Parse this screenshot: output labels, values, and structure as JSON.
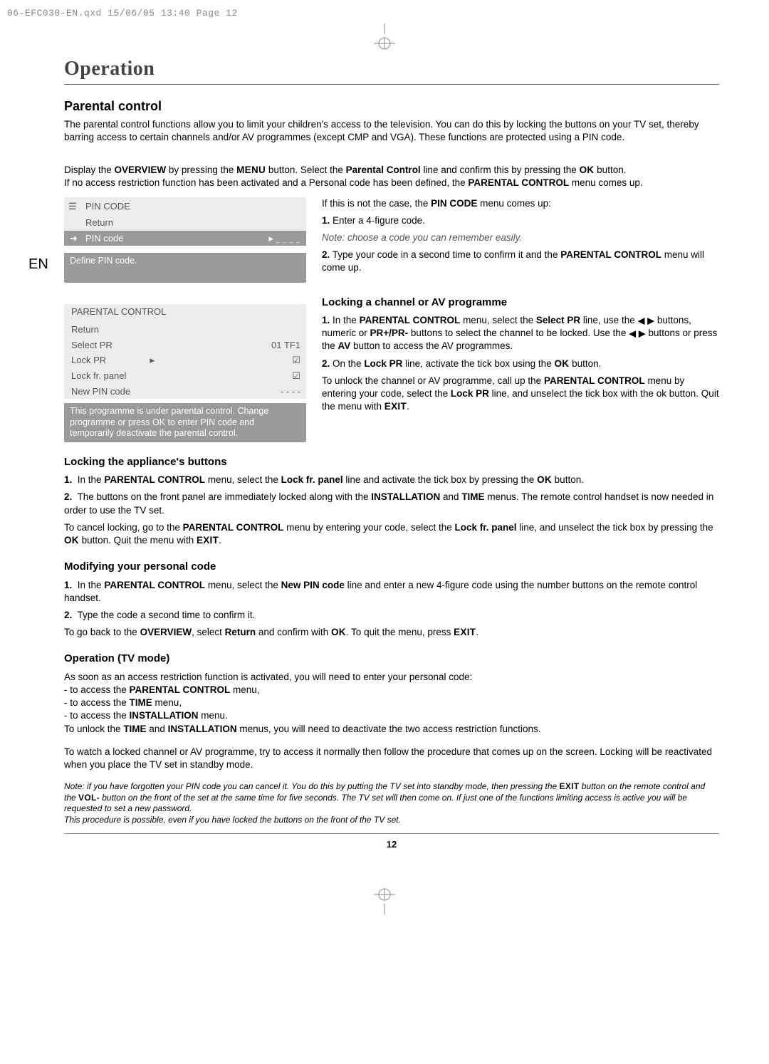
{
  "prepress": "06-EFC030-EN.qxd  15/06/05  13:40  Page 12",
  "side_tab": "EN",
  "chapter": "Operation",
  "section_title": "Parental control",
  "intro": "The parental control functions allow you to limit your children's access to the television. You can do this by locking the buttons on your TV set, thereby barring access to certain channels and/or AV programmes (except CMP and VGA). These functions are protected using a PIN code.",
  "overview_prefix": "Display the ",
  "overview_b1": "OVERVIEW",
  "overview_mid1": " by pressing the ",
  "overview_sc1": "MENU",
  "overview_mid2": " button. Select the ",
  "overview_b2": "Parental Control",
  "overview_mid3": " line and confirm this by pressing the ",
  "overview_sc2": "OK",
  "overview_end": " button.",
  "noaccess_pre": "If no access restriction function has been activated and a Personal code has been defined, the ",
  "noaccess_b": "PARENTAL CONTROL",
  "noaccess_end": " menu comes up.",
  "pin_menu": {
    "title": "PIN CODE",
    "r1": "Return",
    "r2": "PIN code",
    "info": "Define PIN code."
  },
  "pin_text": {
    "line1_pre": "If this is not the case, the ",
    "line1_b": "PIN CODE",
    "line1_end": " menu comes up:",
    "step1": "Enter a 4-figure code.",
    "note": "Note: choose a code you can remember easily.",
    "step2_pre": "Type your code in a second time to confirm it and the ",
    "step2_b": "PARENTAL CONTROL",
    "step2_end": " menu will come up."
  },
  "lock_channel": {
    "heading": "Locking a channel or AV programme",
    "s1_pre": "In the ",
    "s1_b1": "PARENTAL CONTROL",
    "s1_mid1": " menu, select the ",
    "s1_b2": "Select PR",
    "s1_mid2": " line, use the ",
    "s1_mid3": " buttons, numeric or ",
    "s1_b3": "PR+/PR-",
    "s1_mid4": " buttons to select the channel to be locked. Use the ",
    "s1_mid5": " buttons or press the ",
    "s1_b4": "AV",
    "s1_end": " button to access the AV programmes.",
    "s2_pre": "On the ",
    "s2_b": "Lock PR",
    "s2_mid": " line, activate the tick box using the ",
    "s2_sc": "OK",
    "s2_end": " button.",
    "unlock_pre": "To unlock the channel or AV programme, call up the ",
    "unlock_b1": "PARENTAL CONTROL",
    "unlock_mid1": " menu by entering your code, select the ",
    "unlock_b2": "Lock PR",
    "unlock_mid2": " line, and unselect the tick box with the ok button. Quit the menu with ",
    "unlock_sc": "EXIT",
    "unlock_end": "."
  },
  "pc_menu": {
    "title": "PARENTAL CONTROL",
    "r1": "Return",
    "r2": "Select PR",
    "r2v": "01 TF1",
    "r3": "Lock PR",
    "r3v": "☑",
    "r4": "Lock fr. panel",
    "r4v": "☑",
    "r5": "New PIN code",
    "r5v": "- - - -",
    "info": "This programme is under parental control. Change programme or press OK to enter PIN code and temporarily deactivate the parental control."
  },
  "lock_buttons": {
    "heading": "Locking the appliance's buttons",
    "s1_pre": "In the ",
    "s1_b1": "PARENTAL CONTROL",
    "s1_mid": " menu, select the ",
    "s1_b2": "Lock fr. panel",
    "s1_mid2": " line and activate the tick box by pressing the ",
    "s1_sc": "OK",
    "s1_end": " button.",
    "s2_pre": "The buttons on the front panel are immediately locked along with the ",
    "s2_b1": "INSTALLATION",
    "s2_mid": " and ",
    "s2_b2": "TIME",
    "s2_end": " menus. The remote control handset is now needed in order to use the TV set.",
    "cancel_pre": "To cancel locking, go to the ",
    "cancel_b1": "PARENTAL CONTROL",
    "cancel_mid1": " menu by entering your code, select the ",
    "cancel_b2": "Lock fr. panel",
    "cancel_mid2": " line, and unselect the tick box by pressing the ",
    "cancel_sc1": "OK",
    "cancel_mid3": " button. Quit the menu with ",
    "cancel_sc2": "EXIT",
    "cancel_end": "."
  },
  "modify_code": {
    "heading": "Modifying your personal code",
    "s1_pre": "In the ",
    "s1_b1": "PARENTAL CONTROL",
    "s1_mid": " menu, select the ",
    "s1_b2": "New PIN code",
    "s1_end": " line and enter a new 4-figure code using the number buttons on the remote control handset.",
    "s2": "Type the code a second time to confirm it.",
    "back_pre": "To go back to the ",
    "back_b1": "OVERVIEW",
    "back_mid1": ", select ",
    "back_b2": "Return",
    "back_mid2": " and confirm with ",
    "back_sc1": "OK",
    "back_mid3": ". To quit the menu, press ",
    "back_sc2": "EXIT",
    "back_end": "."
  },
  "op_tv": {
    "heading": "Operation (TV mode)",
    "intro": "As soon as an access restriction function is activated, you will need to enter your personal code:",
    "li1_pre": "to access the ",
    "li1_b": "PARENTAL CONTROL",
    "li1_end": " menu,",
    "li2_pre": "to access the ",
    "li2_b": "TIME",
    "li2_end": " menu,",
    "li3_pre": "to access the ",
    "li3_b": "INSTALLATION",
    "li3_end": " menu.",
    "unlock_pre": "To unlock the ",
    "unlock_b1": "TIME",
    "unlock_mid": " and ",
    "unlock_b2": "INSTALLATION",
    "unlock_end": " menus, you will need to deactivate the two access restriction functions.",
    "watch": "To watch a locked channel or AV programme, try to access it normally then follow the procedure that comes up on the screen. Locking will be reactivated when you place the TV set in standby mode."
  },
  "footnote": {
    "l1_pre": "Note: if you have forgotten your PIN code you can cancel it. You do this by putting the TV set into standby mode, then pressing the ",
    "l1_sc1": "EXIT",
    "l1_mid": " button on the remote control and the ",
    "l1_sc2": "VOL-",
    "l1_end": " button on the front of the set at the same time for five seconds. The TV set will then come on. If just one of the functions limiting access is active you will be requested to set a new password.",
    "l2": "This procedure is possible, even if you have locked the buttons on the front of the TV set."
  },
  "pagenum": "12"
}
